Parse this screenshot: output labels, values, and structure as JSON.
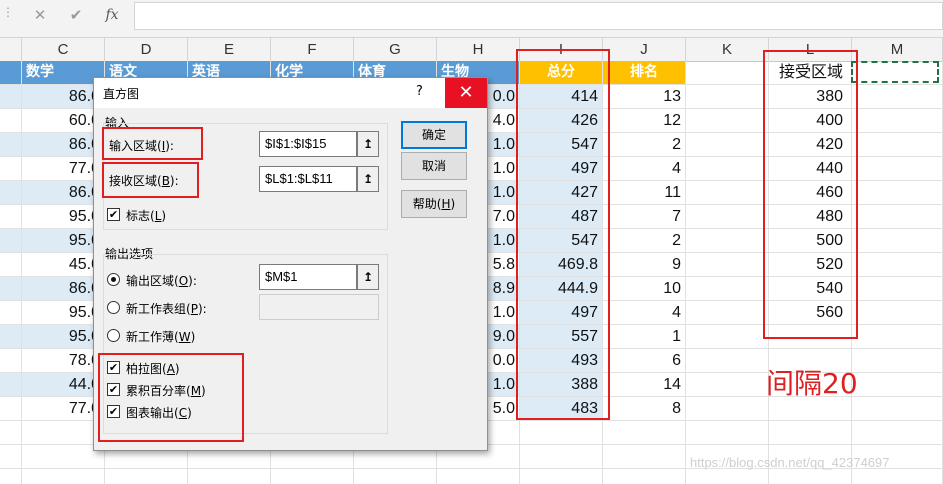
{
  "formula_bar": {
    "cancel_icon": "✕",
    "enter_icon": "✔",
    "fx_label": "fx",
    "value": ""
  },
  "columns": [
    "C",
    "D",
    "E",
    "F",
    "G",
    "H",
    "I",
    "J",
    "K",
    "L",
    "M"
  ],
  "sheet": {
    "header_row": {
      "C": "数学",
      "D": "语文",
      "E": "英语",
      "F": "化学",
      "G": "体育",
      "H": "生物",
      "I": "总分",
      "J": "排名",
      "L": "接受区域"
    },
    "rows": [
      {
        "C": "86.0",
        "H": "0.0",
        "I": "414",
        "J": "13",
        "L": "380"
      },
      {
        "C": "60.0",
        "H": "4.0",
        "I": "426",
        "J": "12",
        "L": "400"
      },
      {
        "C": "86.0",
        "H": "1.0",
        "I": "547",
        "J": "2",
        "L": "420"
      },
      {
        "C": "77.0",
        "H": "1.0",
        "I": "497",
        "J": "4",
        "L": "440"
      },
      {
        "C": "86.0",
        "H": "1.0",
        "I": "427",
        "J": "11",
        "L": "460"
      },
      {
        "C": "95.0",
        "H": "7.0",
        "I": "487",
        "J": "7",
        "L": "480"
      },
      {
        "C": "95.0",
        "H": "1.0",
        "I": "547",
        "J": "2",
        "L": "500"
      },
      {
        "C": "45.0",
        "H": "5.8",
        "I": "469.8",
        "J": "9",
        "L": "520"
      },
      {
        "C": "86.0",
        "H": "8.9",
        "I": "444.9",
        "J": "10",
        "L": "540"
      },
      {
        "C": "95.0",
        "H": "1.0",
        "I": "497",
        "J": "4",
        "L": "560"
      },
      {
        "C": "95.0",
        "H": "9.0",
        "I": "557",
        "J": "1",
        "L": ""
      },
      {
        "C": "78.0",
        "H": "0.0",
        "I": "493",
        "J": "6",
        "L": ""
      },
      {
        "C": "44.0",
        "H": "1.0",
        "I": "388",
        "J": "14",
        "L": ""
      },
      {
        "C": "77.0",
        "H": "5.0",
        "I": "483",
        "J": "8",
        "L": ""
      }
    ]
  },
  "dialog": {
    "title": "直方图",
    "help_glyph": "?",
    "close_glyph": "✕",
    "input_group": "输入",
    "input_range_label": "输入区域(",
    "input_range_key": "I",
    "input_range_suffix": "):",
    "input_range_value": "$I$1:$I$15",
    "bin_range_label": "接收区域(",
    "bin_range_key": "B",
    "bin_range_suffix": "):",
    "bin_range_value": "$L$1:$L$11",
    "labels_label": "标志(",
    "labels_key": "L",
    "labels_suffix": ")",
    "labels_checked": true,
    "output_group": "输出选项",
    "output_range_label": "输出区域(",
    "output_range_key": "O",
    "output_range_suffix": "):",
    "output_range_value": "$M$1",
    "new_ply_label": "新工作表组(",
    "new_ply_key": "P",
    "new_ply_suffix": "):",
    "new_workbook_label": "新工作薄(",
    "new_workbook_key": "W",
    "new_workbook_suffix": ")",
    "pareto_label": "柏拉图(",
    "pareto_key": "A",
    "pareto_suffix": ")",
    "cumulative_label": "累积百分率(",
    "cumulative_key": "M",
    "cumulative_suffix": ")",
    "chart_output_label": "图表输出(",
    "chart_output_key": "C",
    "chart_output_suffix": ")",
    "ok_label": "确定",
    "cancel_label": "取消",
    "help_label": "帮助(",
    "help_key": "H",
    "help_suffix": ")",
    "ref_glyph": "↥"
  },
  "annotation": {
    "text": "间隔20",
    "color": "#e02020"
  },
  "watermark": "https://blog.csdn.net/qq_42374697",
  "colors": {
    "header_blue": "#5b9bd5",
    "total_gold": "#ffc000",
    "band_blue": "#ddebf7",
    "close_red": "#e81123",
    "selection_green": "#217346"
  }
}
